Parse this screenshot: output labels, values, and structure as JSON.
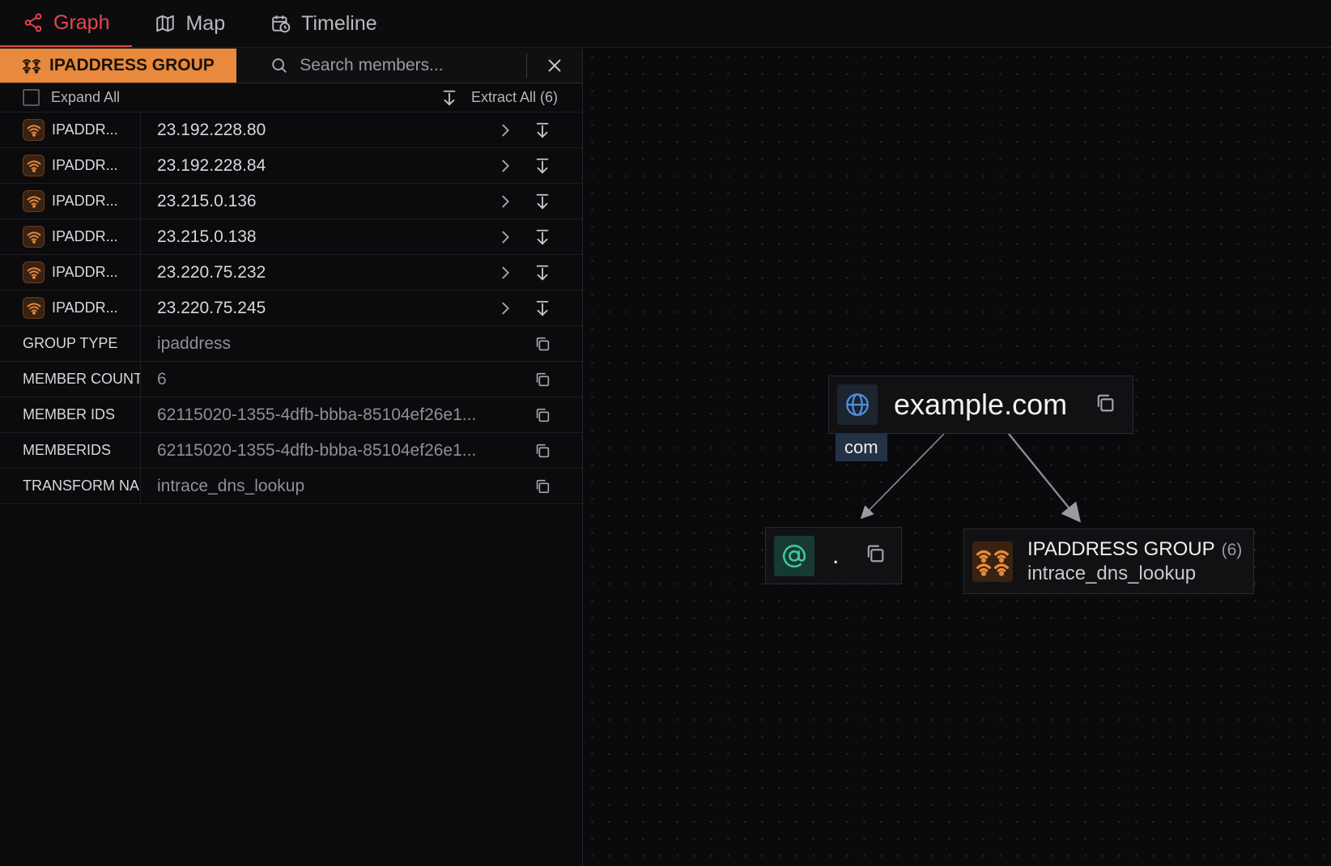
{
  "tabs": [
    {
      "label": "Graph",
      "icon": "share-graph-icon",
      "active": true
    },
    {
      "label": "Map",
      "icon": "map-icon",
      "active": false
    },
    {
      "label": "Timeline",
      "icon": "calendar-clock-icon",
      "active": false
    }
  ],
  "panel": {
    "group_label": "IPADDRESS GROUP",
    "search_placeholder": "Search members...",
    "expand_all_label": "Expand All",
    "extract_all_label": "Extract All (6)",
    "members": [
      {
        "type": "IPADDR...",
        "value": "23.192.228.80"
      },
      {
        "type": "IPADDR...",
        "value": "23.192.228.84"
      },
      {
        "type": "IPADDR...",
        "value": "23.215.0.136"
      },
      {
        "type": "IPADDR...",
        "value": "23.215.0.138"
      },
      {
        "type": "IPADDR...",
        "value": "23.220.75.232"
      },
      {
        "type": "IPADDR...",
        "value": "23.220.75.245"
      }
    ],
    "properties": [
      {
        "key": "GROUP TYPE",
        "value": "ipaddress"
      },
      {
        "key": "MEMBER COUNT",
        "value": "6"
      },
      {
        "key": "MEMBER IDS",
        "value": "62115020-1355-4dfb-bbba-85104ef26e1..."
      },
      {
        "key": "MEMBERIDS",
        "value": "62115020-1355-4dfb-bbba-85104ef26e1..."
      },
      {
        "key": "TRANSFORM NA",
        "value": "intrace_dns_lookup"
      }
    ]
  },
  "graph": {
    "domain_node": {
      "title": "example.com",
      "badge": "com",
      "icon": "globe-icon"
    },
    "email_node": {
      "title": ".",
      "icon": "at-sign-icon"
    },
    "group_node": {
      "title": "IPADDRESS GROUP",
      "count": "(6)",
      "subtitle": "intrace_dns_lookup",
      "icon": "wifi-group-icon"
    }
  },
  "colors": {
    "accent_red": "#e5484d",
    "group_orange": "#e8893d",
    "background": "#0a0a0c"
  }
}
